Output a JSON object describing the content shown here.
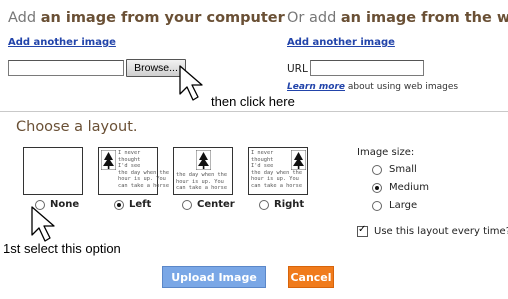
{
  "computer_section": {
    "title_prefix": "Add ",
    "title_strong": "an image from your computer",
    "add_another": "Add another image",
    "browse_label": "Browse..."
  },
  "web_section": {
    "title_prefix": "Or add ",
    "title_strong": "an image from the web",
    "add_another": "Add another image",
    "url_label": "URL",
    "learn_more": "Learn more",
    "learn_more_suffix": " about using web images"
  },
  "annotations": {
    "then_click": "then click here",
    "first_select": "1st select this option"
  },
  "layout": {
    "title": "Choose a layout.",
    "options": [
      {
        "label": "None",
        "selected": false
      },
      {
        "label": "Left",
        "selected": true
      },
      {
        "label": "Center",
        "selected": false
      },
      {
        "label": "Right",
        "selected": false
      }
    ],
    "sample_text": "I never\nthought\nI'd see\nthe day when the\nhour is up. You\ncan take a horse"
  },
  "image_size": {
    "title": "Image size:",
    "options": [
      {
        "label": "Small",
        "selected": false
      },
      {
        "label": "Medium",
        "selected": true
      },
      {
        "label": "Large",
        "selected": false
      }
    ],
    "remember_label": "Use this layout every time?",
    "remember_checked": true
  },
  "actions": {
    "upload": "Upload Image",
    "cancel": "Cancel"
  },
  "colors": {
    "title_accent": "#6a5035",
    "link": "#2244aa",
    "upload_button": "#7aa7e6",
    "cancel_button": "#f07b1c"
  }
}
